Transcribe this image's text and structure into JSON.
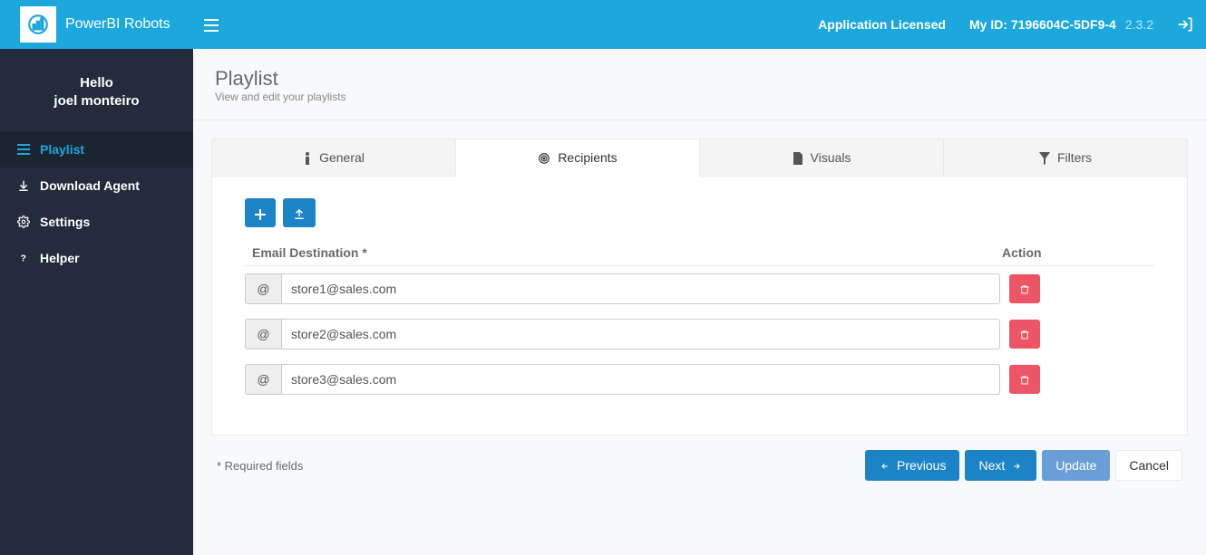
{
  "brand": {
    "name": "PowerBI Robots"
  },
  "header": {
    "license_text": "Application Licensed",
    "id_label": "My ID: 7196604C-5DF9-4",
    "version": "2.3.2"
  },
  "user": {
    "greeting": "Hello",
    "name": "joel monteiro"
  },
  "sidebar": {
    "items": [
      {
        "label": "Playlist",
        "icon": "list-icon",
        "active": true
      },
      {
        "label": "Download Agent",
        "icon": "download-icon",
        "active": false
      },
      {
        "label": "Settings",
        "icon": "gear-icon",
        "active": false
      },
      {
        "label": "Helper",
        "icon": "question-icon",
        "active": false
      }
    ]
  },
  "page": {
    "title": "Playlist",
    "subtitle": "View and edit your playlists"
  },
  "tabs": [
    {
      "label": "General",
      "icon": "info-icon"
    },
    {
      "label": "Recipients",
      "icon": "target-icon"
    },
    {
      "label": "Visuals",
      "icon": "file-icon"
    },
    {
      "label": "Filters",
      "icon": "funnel-icon"
    }
  ],
  "active_tab": 1,
  "recipients": {
    "header_email": "Email Destination *",
    "header_action": "Action",
    "rows": [
      {
        "email": "store1@sales.com"
      },
      {
        "email": "store2@sales.com"
      },
      {
        "email": "store3@sales.com"
      }
    ]
  },
  "footer": {
    "required_note": "* Required fields",
    "previous": "Previous",
    "next": "Next",
    "update": "Update",
    "cancel": "Cancel"
  }
}
